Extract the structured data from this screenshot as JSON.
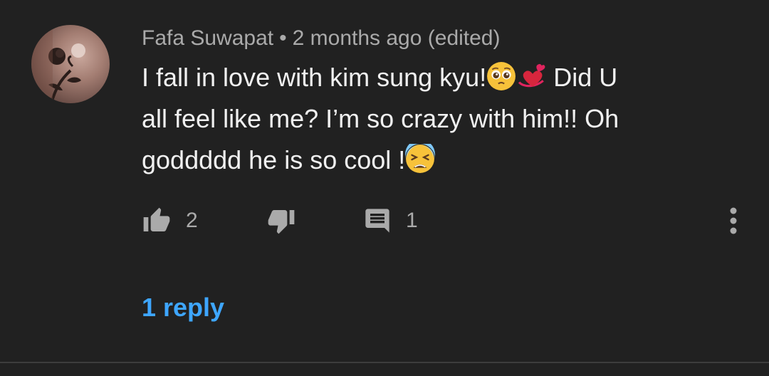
{
  "comment": {
    "author": "Fafa Suwapat",
    "separator": "•",
    "timestamp": "2 months ago (edited)",
    "text_line1_a": "I fall in love with kim sung kyu!",
    "text_line1_b": " Did U",
    "text_line2": "all feel like me? I’m so crazy with him!! Oh",
    "text_line3": "goddddd he is so cool !",
    "emojis": [
      "pleading-face-emoji",
      "revolving-hearts-emoji",
      "tired-face-emoji"
    ]
  },
  "actions": {
    "like_count": "2",
    "reply_count": "1",
    "icons": [
      "thumbs-up-icon",
      "thumbs-down-icon",
      "comment-icon",
      "more-vert-icon"
    ]
  },
  "replies_link": "1 reply",
  "colors": {
    "background": "#212121",
    "text_primary": "#f1f1f1",
    "text_secondary": "#aaaaaa",
    "link": "#3ea6ff",
    "divider": "#3d3d3d"
  }
}
